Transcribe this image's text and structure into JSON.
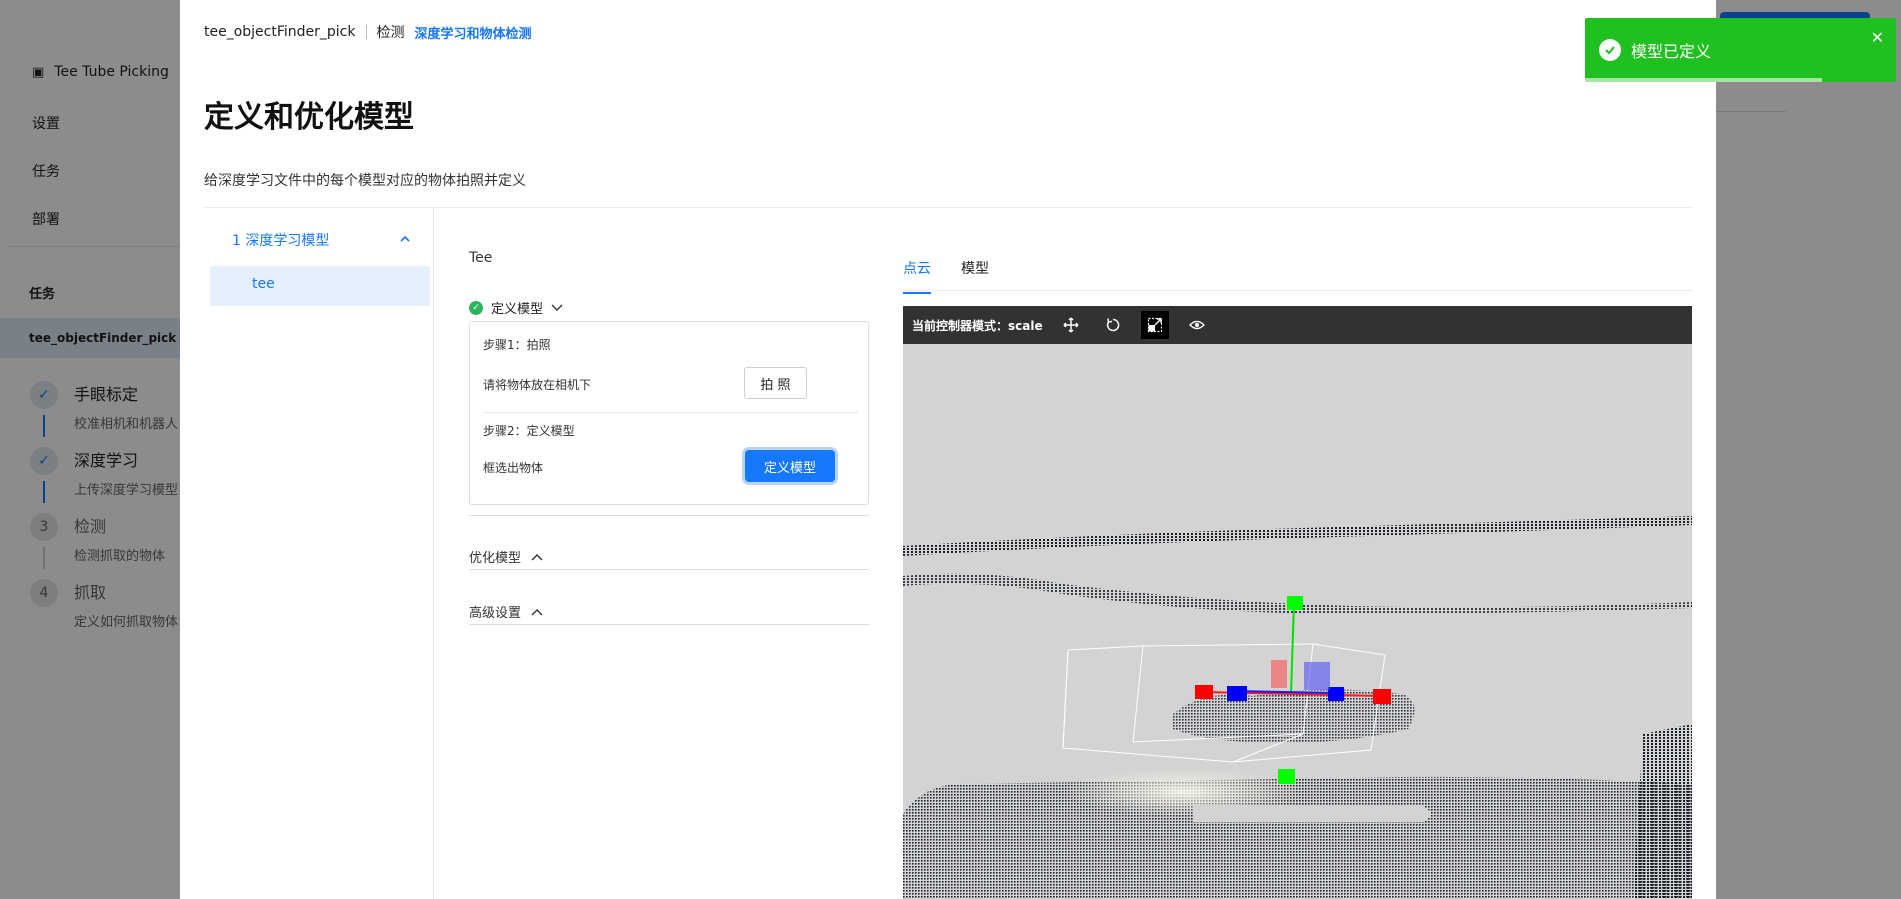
{
  "bg": {
    "nav": [
      {
        "label": "Tee Tube Picking"
      },
      {
        "label": "设置"
      },
      {
        "label": "任务"
      },
      {
        "label": "部署"
      }
    ],
    "tasks_title": "任务",
    "task_item": "tee_objectFinder_pick",
    "steps": [
      {
        "num": "✓",
        "title": "手眼标定",
        "desc": "校准相机和机器人"
      },
      {
        "num": "✓",
        "title": "深度学习",
        "desc": "上传深度学习模型"
      },
      {
        "num": "3",
        "title": "检测",
        "desc": "检测抓取的物体"
      },
      {
        "num": "4",
        "title": "抓取",
        "desc": "定义如何抓取物体"
      }
    ]
  },
  "modal": {
    "breadcrumb": {
      "project": "tee_objectFinder_pick",
      "section": "检测",
      "current": "深度学习和物体检测"
    },
    "title": "定义和优化模型",
    "description": "给深度学习文件中的每个模型对应的物体拍照并定义",
    "tree": {
      "group": "1 深度学习模型",
      "item": "tee"
    },
    "panel": {
      "object_name": "Tee",
      "define_section": "定义模型",
      "step1_label": "步骤1：拍照",
      "step1_text": "请将物体放在相机下",
      "photo_button": "拍 照",
      "step2_label": "步骤2：定义模型",
      "step2_text": "框选出物体",
      "define_button": "定义模型",
      "optimize_section": "优化模型",
      "advanced_section": "高级设置"
    },
    "viewer": {
      "tabs": [
        "点云",
        "模型"
      ],
      "mode_label": "当前控制器模式：scale"
    }
  },
  "toast": {
    "message": "模型已定义",
    "color": "#1fc01f"
  }
}
